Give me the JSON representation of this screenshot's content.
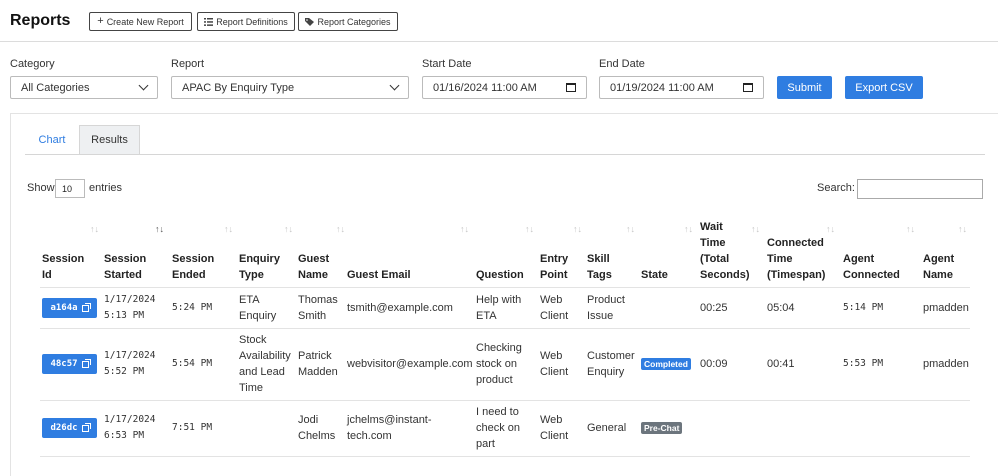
{
  "page": {
    "title": "Reports"
  },
  "toolbar": {
    "create_label": "Create New Report",
    "definitions_label": "Report Definitions",
    "categories_label": "Report Categories"
  },
  "filters": {
    "category_label": "Category",
    "category_value": "All Categories",
    "report_label": "Report",
    "report_value": "APAC By Enquiry Type",
    "start_label": "Start Date",
    "start_value": "01/16/2024 11:00 AM",
    "end_label": "End Date",
    "end_value": "01/19/2024 11:00 AM",
    "submit_label": "Submit",
    "export_label": "Export CSV"
  },
  "tabs": {
    "chart": "Chart",
    "results": "Results"
  },
  "table_controls": {
    "show_label": "Show",
    "entries_value": "10",
    "entries_label": "entries",
    "search_label": "Search:"
  },
  "columns": [
    "Session Id",
    "Session Started",
    "Session Ended",
    "Enquiry Type",
    "Guest Name",
    "Guest Email",
    "Question",
    "Entry Point",
    "Skill Tags",
    "State",
    "Wait Time (Total Seconds)",
    "Connected Time (Timespan)",
    "Agent Connected",
    "Agent Name"
  ],
  "rows": [
    {
      "id": "a164a",
      "started": [
        "1/17/2024",
        "5:13 PM"
      ],
      "ended": "5:24 PM",
      "enquiry": [
        "ETA",
        "Enquiry"
      ],
      "guest": [
        "Thomas",
        "Smith"
      ],
      "email": [
        "tsmith@example.com"
      ],
      "question": [
        "Help with",
        "ETA"
      ],
      "entry": [
        "Web",
        "Client"
      ],
      "skill": [
        "Product",
        "Issue"
      ],
      "state": "",
      "wait": "00:25",
      "connected": "05:04",
      "agent_connected": "5:14 PM",
      "agent": "pmadden"
    },
    {
      "id": "48c57",
      "started": [
        "1/17/2024",
        "5:52 PM"
      ],
      "ended": "5:54 PM",
      "enquiry": [
        "Stock",
        "Availability",
        "and Lead",
        "Time"
      ],
      "guest": [
        "Patrick",
        "Madden"
      ],
      "email": [
        "webvisitor@example.com"
      ],
      "question": [
        "Checking",
        "stock on",
        "product"
      ],
      "entry": [
        "Web",
        "Client"
      ],
      "skill": [
        "Customer",
        "Enquiry"
      ],
      "state": "Completed",
      "wait": "00:09",
      "connected": "00:41",
      "agent_connected": "5:53 PM",
      "agent": "pmadden"
    },
    {
      "id": "d26dc",
      "started": [
        "1/17/2024",
        "6:53 PM"
      ],
      "ended": "7:51 PM",
      "enquiry": [],
      "guest": [
        "Jodi",
        "Chelms"
      ],
      "email": [
        "jchelms@instant-",
        "tech.com"
      ],
      "question": [
        "I need to",
        "check on",
        "part"
      ],
      "entry": [
        "Web",
        "Client"
      ],
      "skill": [
        "General"
      ],
      "state": "Pre-Chat",
      "wait": "",
      "connected": "",
      "agent_connected": "",
      "agent": ""
    }
  ],
  "colors": {
    "primary": "#2f7de1",
    "badge_completed": "#2f7de1",
    "badge_prechat": "#6c757d"
  },
  "icons": [
    "plus-icon",
    "list-icon",
    "tag-icon",
    "chevron-down-icon",
    "calendar-icon",
    "external-link-icon",
    "sort-icon"
  ]
}
